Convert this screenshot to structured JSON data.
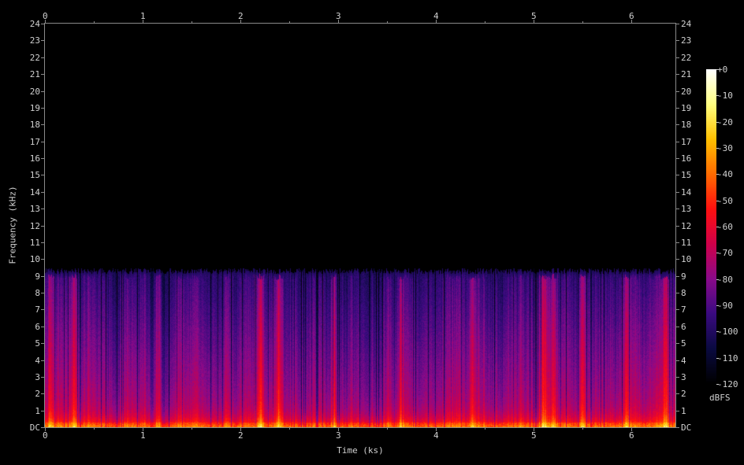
{
  "chart_data": {
    "type": "heatmap",
    "subtype": "spectrogram",
    "xlabel": "Time (ks)",
    "ylabel": "Frequency (kHz)",
    "xlim": [
      0,
      6.45
    ],
    "ylim": [
      0,
      24
    ],
    "x_ticks": [
      "0",
      "1",
      "2",
      "3",
      "4",
      "5",
      "6"
    ],
    "y_ticks": [
      "DC",
      "1",
      "2",
      "3",
      "4",
      "5",
      "6",
      "7",
      "8",
      "9",
      "10",
      "11",
      "12",
      "13",
      "14",
      "15",
      "16",
      "17",
      "18",
      "19",
      "20",
      "21",
      "22",
      "23",
      "24"
    ],
    "colorbar": {
      "label": "dBFS",
      "range": [
        -120,
        0
      ],
      "ticks": [
        "+0",
        "-10",
        "-20",
        "-30",
        "-40",
        "-50",
        "-60",
        "-70",
        "-80",
        "-90",
        "-100",
        "-110",
        "-120"
      ],
      "colormap": [
        "#000000",
        "#0a0a40",
        "#3a0a80",
        "#8a0a8a",
        "#d0004a",
        "#ff1010",
        "#ff6a00",
        "#ffc000",
        "#ffff80",
        "#ffffff"
      ]
    },
    "energy_cutoff_khz": 9.2,
    "bright_bursts_ks": [
      0.05,
      0.3,
      1.15,
      2.2,
      2.4,
      2.95,
      3.65,
      4.37,
      5.1,
      5.2,
      5.5,
      5.95,
      6.35
    ]
  }
}
